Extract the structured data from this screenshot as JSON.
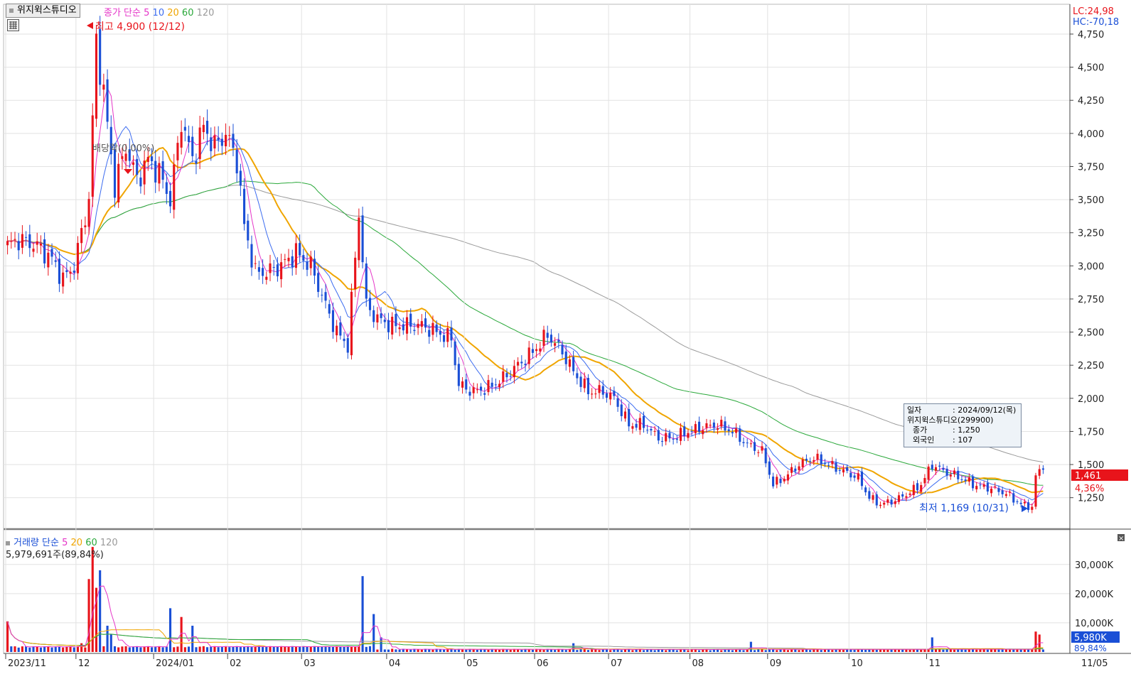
{
  "stock_tab": {
    "label": "위지윅스튜디오"
  },
  "price_legend": {
    "label": "종가 단순",
    "periods": [
      "5",
      "10",
      "20",
      "60",
      "120"
    ]
  },
  "volume_legend": {
    "label": "거래량 단순",
    "periods": [
      "5",
      "20",
      "60",
      "120"
    ]
  },
  "volume_info": "5,979,691주(89,84%)",
  "lc_label": "LC:24,98",
  "hc_label": "HC:-70,18",
  "high_annotation": "최고 4,900 (12/12)",
  "low_annotation": "최저 1,169 (10/31)",
  "dividend_annotation": "배당락(0,00%)",
  "current_price_tag": "1,461",
  "current_change_tag": "4,36%",
  "current_volume_tag": "5,980K",
  "current_volume_pct": "89,84%",
  "tooltip": {
    "rows": [
      {
        "k": "일자",
        "v": ": 2024/09/12(목)"
      },
      {
        "k": "위지윅스튜디오(299900)",
        "v": ""
      },
      {
        "k": "종가",
        "v": ": 1,250"
      },
      {
        "k": "외국인",
        "v": ": 107"
      }
    ]
  },
  "colors": {
    "up": "#e8141b",
    "down": "#1a4fd6",
    "ma5": "#e535c8",
    "ma10": "#3c6cf0",
    "ma20": "#f0a500",
    "ma60": "#2aa83a",
    "ma120": "#9a9a9a"
  },
  "chart_data": [
    {
      "type": "candlestick",
      "x_ticks": [
        "2023/11",
        "12",
        "2024/01",
        "02",
        "03",
        "04",
        "05",
        "06",
        "07",
        "08",
        "09",
        "10",
        "11",
        "11/05"
      ],
      "y_ticks": [
        "1,250",
        "1,500",
        "1,750",
        "2,000",
        "2,250",
        "2,500",
        "2,750",
        "3,000",
        "3,250",
        "3,500",
        "3,750",
        "4,000",
        "4,250",
        "4,500",
        "4,750"
      ],
      "ylim": [
        1050,
        4900
      ],
      "anchors": [
        [
          0,
          3150
        ],
        [
          3,
          3200
        ],
        [
          8,
          3150
        ],
        [
          12,
          3050
        ],
        [
          15,
          2900
        ],
        [
          18,
          3000
        ],
        [
          22,
          3500
        ],
        [
          24,
          4700
        ],
        [
          26,
          4300
        ],
        [
          29,
          3600
        ],
        [
          32,
          3900
        ],
        [
          35,
          3650
        ],
        [
          38,
          3800
        ],
        [
          41,
          3700
        ],
        [
          44,
          3500
        ],
        [
          47,
          4100
        ],
        [
          50,
          3800
        ],
        [
          53,
          4050
        ],
        [
          56,
          3900
        ],
        [
          59,
          4000
        ],
        [
          62,
          3800
        ],
        [
          64,
          3300
        ],
        [
          67,
          2950
        ],
        [
          70,
          2950
        ],
        [
          74,
          3000
        ],
        [
          78,
          3100
        ],
        [
          82,
          3000
        ],
        [
          86,
          2700
        ],
        [
          89,
          2500
        ],
        [
          92,
          2400
        ],
        [
          95,
          3400
        ],
        [
          97,
          2700
        ],
        [
          100,
          2600
        ],
        [
          104,
          2550
        ],
        [
          108,
          2550
        ],
        [
          112,
          2550
        ],
        [
          116,
          2500
        ],
        [
          120,
          2450
        ],
        [
          122,
          2100
        ],
        [
          126,
          2050
        ],
        [
          130,
          2080
        ],
        [
          134,
          2150
        ],
        [
          138,
          2250
        ],
        [
          142,
          2350
        ],
        [
          146,
          2480
        ],
        [
          150,
          2350
        ],
        [
          153,
          2200
        ],
        [
          157,
          2050
        ],
        [
          161,
          2050
        ],
        [
          164,
          2000
        ],
        [
          168,
          1800
        ],
        [
          172,
          1800
        ],
        [
          176,
          1700
        ],
        [
          180,
          1700
        ],
        [
          184,
          1750
        ],
        [
          188,
          1780
        ],
        [
          192,
          1800
        ],
        [
          196,
          1750
        ],
        [
          200,
          1650
        ],
        [
          204,
          1600
        ],
        [
          207,
          1350
        ],
        [
          210,
          1400
        ],
        [
          214,
          1500
        ],
        [
          218,
          1550
        ],
        [
          222,
          1500
        ],
        [
          226,
          1450
        ],
        [
          230,
          1400
        ],
        [
          233,
          1250
        ],
        [
          236,
          1200
        ],
        [
          240,
          1230
        ],
        [
          244,
          1290
        ],
        [
          247,
          1350
        ],
        [
          250,
          1500
        ],
        [
          253,
          1450
        ],
        [
          256,
          1420
        ],
        [
          259,
          1380
        ],
        [
          262,
          1340
        ],
        [
          266,
          1320
        ],
        [
          270,
          1280
        ],
        [
          274,
          1200
        ],
        [
          277,
          1180
        ],
        [
          278,
          1400
        ],
        [
          279,
          1461
        ]
      ],
      "volume": {
        "y_ticks": [
          "10,000K",
          "20,000K",
          "30,000K"
        ],
        "ylim": [
          0,
          37000
        ],
        "spikes": [
          [
            0,
            10500
          ],
          [
            20,
            3000
          ],
          [
            22,
            25000
          ],
          [
            23,
            36000
          ],
          [
            24,
            22000
          ],
          [
            25,
            28000
          ],
          [
            27,
            9000
          ],
          [
            28,
            6000
          ],
          [
            44,
            15000
          ],
          [
            47,
            12000
          ],
          [
            50,
            9000
          ],
          [
            96,
            26000
          ],
          [
            99,
            13000
          ],
          [
            101,
            5000
          ],
          [
            153,
            3000
          ],
          [
            201,
            3500
          ],
          [
            250,
            5000
          ],
          [
            278,
            7000
          ],
          [
            279,
            5980
          ]
        ]
      }
    }
  ]
}
